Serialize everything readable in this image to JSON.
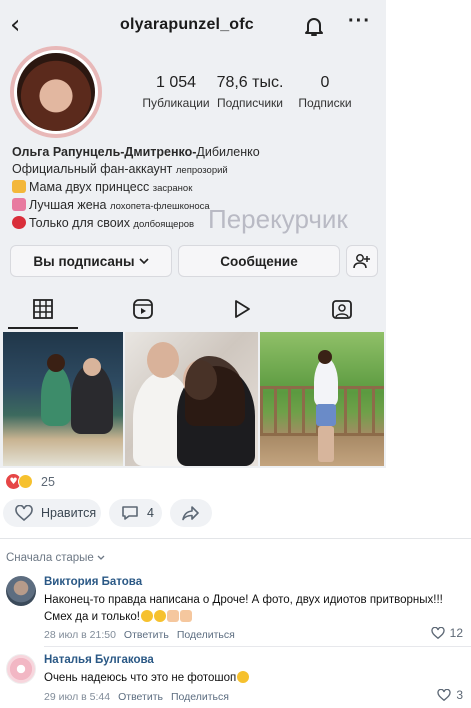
{
  "instagram": {
    "username": "olyarapunzel_ofc",
    "stats": [
      {
        "value": "1 054",
        "label": "Публикации"
      },
      {
        "value": "78,6 тыс.",
        "label": "Подписчики"
      },
      {
        "value": "0",
        "label": "Подписки"
      }
    ],
    "bio": {
      "name": "Ольга Рапунцель-Дмитренко-",
      "name_suffix": "Дибиленко",
      "line1": "Официальный фан-аккаунт ",
      "line1_suffix": "лепрозорий",
      "line2": "Мама двух принцесс ",
      "line2_suffix": "засранок",
      "line3": "Лучшая жена ",
      "line3_suffix": "лохопета-флешконоса",
      "line4": "Только для своих ",
      "line4_suffix": "долбоящеров"
    },
    "watermark": "Перекурчик",
    "buttons": {
      "following": "Вы подписаны",
      "message": "Сообщение"
    }
  },
  "post": {
    "reactions_count": "25",
    "like_label": "Нравится",
    "comments_count": "4"
  },
  "comments_sort": "Сначала старые",
  "comments": [
    {
      "author": "Виктория Батова",
      "line1": "Наконец-то правда написана о Дроче! А фото, двух идиотов притворных!!!",
      "line2": "Смех да и только!",
      "time": "28 июл в 21:50",
      "reply": "Ответить",
      "share": "Поделиться",
      "likes": "12"
    },
    {
      "author": "Наталья Булгакова",
      "line1": "Очень надеюсь что это не фотошоп",
      "time": "29 июл в 5:44",
      "reply": "Ответить",
      "share": "Поделиться",
      "likes": "3"
    }
  ],
  "colors": {
    "link": "#2a5885",
    "secondary": "#818c99",
    "button_bg": "#f0f2f5",
    "heart": "#e64646"
  }
}
